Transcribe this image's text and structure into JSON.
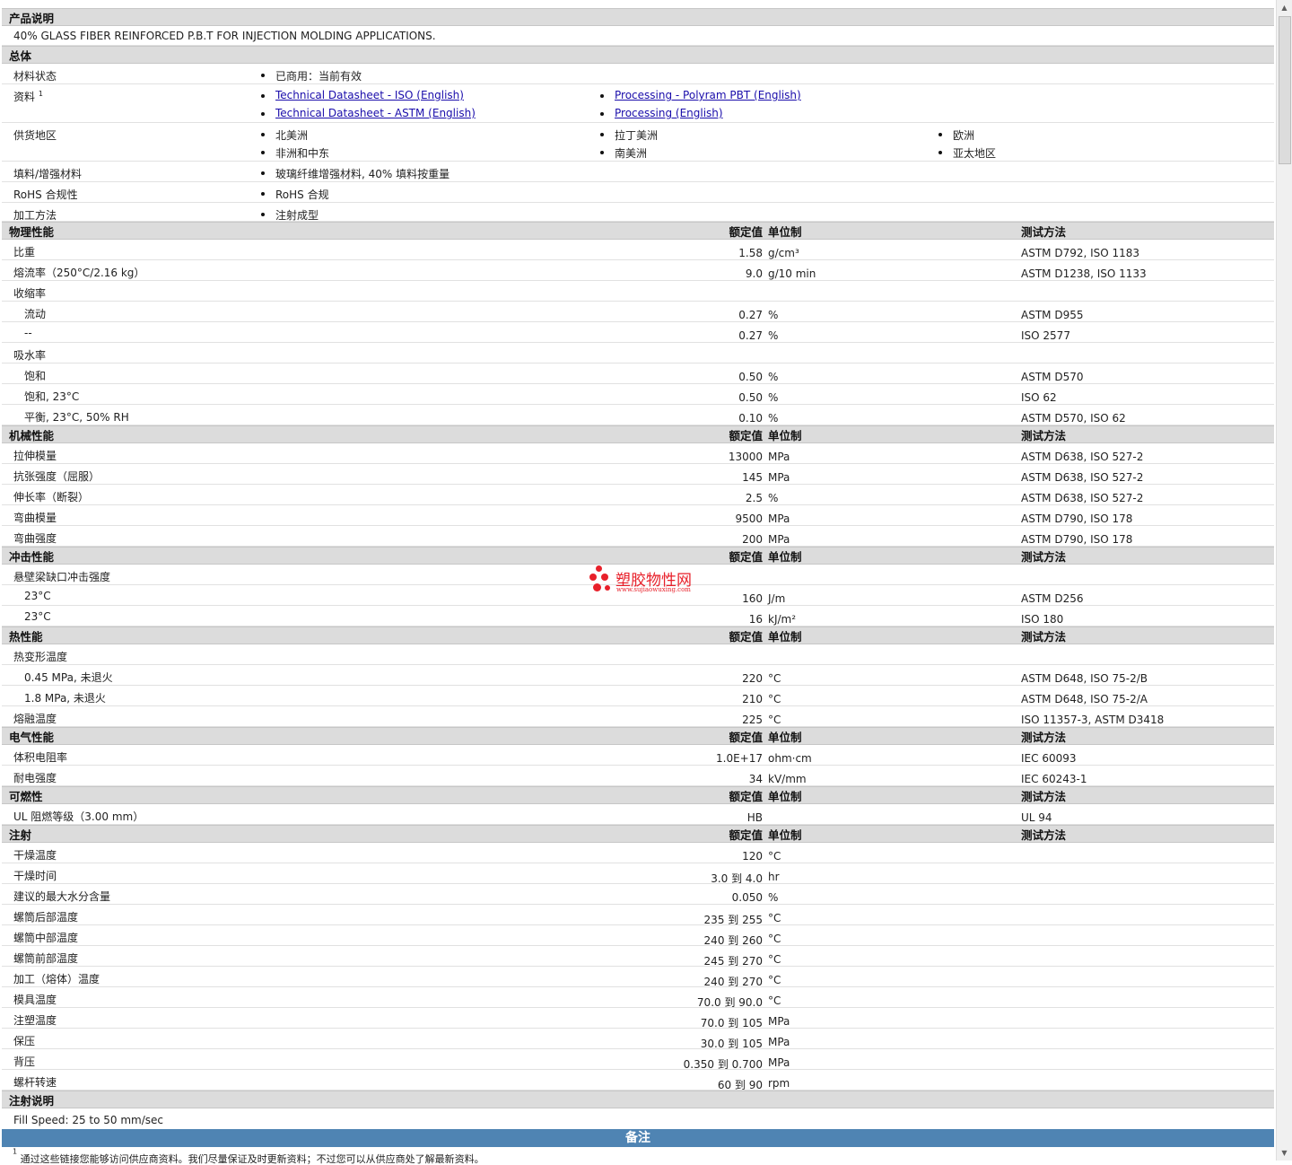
{
  "product_description": {
    "title": "产品说明",
    "text": "40% GLASS FIBER REINFORCED P.B.T FOR INJECTION MOLDING APPLICATIONS."
  },
  "general": {
    "title": "总体",
    "material_status": {
      "label": "材料状态",
      "value": "已商用：当前有效"
    },
    "documents": {
      "label": "资料",
      "sup": "1",
      "links": [
        "Technical Datasheet - ISO (English)",
        "Processing - Polyram PBT (English)",
        "Technical Datasheet - ASTM (English)",
        "Processing (English)"
      ]
    },
    "supply_regions": {
      "label": "供货地区",
      "items": [
        "北美洲",
        "拉丁美洲",
        "欧洲",
        "非洲和中东",
        "南美洲",
        "亚太地区"
      ]
    },
    "filler": {
      "label": "填料/增强材料",
      "value": "玻璃纤维增强材料, 40% 填料按重量"
    },
    "rohs": {
      "label": "RoHS 合规性",
      "value": "RoHS 合规"
    },
    "processing_method": {
      "label": "加工方法",
      "value": "注射成型"
    }
  },
  "headers": {
    "nominal": "额定值",
    "unit": "单位制",
    "method": "测试方法"
  },
  "physical": {
    "title": "物理性能",
    "rows": [
      {
        "label": "比重",
        "value": "1.58",
        "unit": "g/cm³",
        "method": "ASTM D792, ISO 1183"
      },
      {
        "label": "熔流率（250°C/2.16 kg）",
        "value": "9.0",
        "unit": "g/10 min",
        "method": "ASTM D1238, ISO 1133"
      },
      {
        "label": "收缩率",
        "value": "",
        "unit": "",
        "method": ""
      },
      {
        "label": "流动",
        "value": "0.27",
        "unit": "%",
        "method": "ASTM D955"
      },
      {
        "label": "--",
        "value": "0.27",
        "unit": "%",
        "method": "ISO 2577"
      },
      {
        "label": "吸水率",
        "value": "",
        "unit": "",
        "method": ""
      },
      {
        "label": "饱和",
        "value": "0.50",
        "unit": "%",
        "method": "ASTM D570"
      },
      {
        "label": "饱和, 23°C",
        "value": "0.50",
        "unit": "%",
        "method": "ISO 62"
      },
      {
        "label": "平衡, 23°C, 50% RH",
        "value": "0.10",
        "unit": "%",
        "method": "ASTM D570, ISO 62"
      }
    ]
  },
  "mechanical": {
    "title": "机械性能",
    "rows": [
      {
        "label": "拉伸模量",
        "value": "13000",
        "unit": "MPa",
        "method": "ASTM D638, ISO 527-2"
      },
      {
        "label": "抗张强度（屈服）",
        "value": "145",
        "unit": "MPa",
        "method": "ASTM D638, ISO 527-2"
      },
      {
        "label": "伸长率（断裂）",
        "value": "2.5",
        "unit": "%",
        "method": "ASTM D638, ISO 527-2"
      },
      {
        "label": "弯曲模量",
        "value": "9500",
        "unit": "MPa",
        "method": "ASTM D790, ISO 178"
      },
      {
        "label": "弯曲强度",
        "value": "200",
        "unit": "MPa",
        "method": "ASTM D790, ISO 178"
      }
    ]
  },
  "impact": {
    "title": "冲击性能",
    "rows": [
      {
        "label": "悬壁梁缺口冲击强度",
        "value": "",
        "unit": "",
        "method": ""
      },
      {
        "label": "23°C",
        "value": "160",
        "unit": "J/m",
        "method": "ASTM D256"
      },
      {
        "label": "23°C",
        "value": "16",
        "unit": "kJ/m²",
        "method": "ISO 180"
      }
    ]
  },
  "thermal": {
    "title": "热性能",
    "rows": [
      {
        "label": "热变形温度",
        "value": "",
        "unit": "",
        "method": ""
      },
      {
        "label": "0.45 MPa, 未退火",
        "value": "220",
        "unit": "°C",
        "method": "ASTM D648, ISO 75-2/B"
      },
      {
        "label": "1.8 MPa, 未退火",
        "value": "210",
        "unit": "°C",
        "method": "ASTM D648, ISO 75-2/A"
      },
      {
        "label": "熔融温度",
        "value": "225",
        "unit": "°C",
        "method": "ISO 11357-3, ASTM D3418"
      }
    ]
  },
  "electrical": {
    "title": "电气性能",
    "rows": [
      {
        "label": "体积电阻率",
        "value": "1.0E+17",
        "unit": "ohm·cm",
        "method": "IEC 60093"
      },
      {
        "label": "耐电强度",
        "value": "34",
        "unit": "kV/mm",
        "method": "IEC 60243-1"
      }
    ]
  },
  "flammability": {
    "title": "可燃性",
    "rows": [
      {
        "label": "UL 阻燃等级（3.00 mm）",
        "value": "HB",
        "unit": "",
        "method": "UL 94"
      }
    ]
  },
  "injection": {
    "title": "注射",
    "rows": [
      {
        "label": "干燥温度",
        "value": "120",
        "unit": "°C",
        "method": ""
      },
      {
        "label": "干燥时间",
        "value": "3.0 到  4.0",
        "unit": "hr",
        "method": ""
      },
      {
        "label": "建议的最大水分含量",
        "value": "0.050",
        "unit": "%",
        "method": ""
      },
      {
        "label": "螺筒后部温度",
        "value": "235 到  255",
        "unit": "°C",
        "method": ""
      },
      {
        "label": "螺筒中部温度",
        "value": "240 到  260",
        "unit": "°C",
        "method": ""
      },
      {
        "label": "螺筒前部温度",
        "value": "245 到  270",
        "unit": "°C",
        "method": ""
      },
      {
        "label": "加工（熔体）温度",
        "value": "240 到  270",
        "unit": "°C",
        "method": ""
      },
      {
        "label": "模具温度",
        "value": "70.0 到  90.0",
        "unit": "°C",
        "method": ""
      },
      {
        "label": "注塑温度",
        "value": "70.0 到  105",
        "unit": "MPa",
        "method": ""
      },
      {
        "label": "保压",
        "value": "30.0 到  105",
        "unit": "MPa",
        "method": ""
      },
      {
        "label": "背压",
        "value": "0.350 到  0.700",
        "unit": "MPa",
        "method": ""
      },
      {
        "label": "螺杆转速",
        "value": "60 到  90",
        "unit": "rpm",
        "method": ""
      }
    ]
  },
  "injection_notes": {
    "title": "注射说明",
    "text": "Fill Speed: 25 to 50 mm/sec"
  },
  "remarks": {
    "title": "备注",
    "footnote_num": "1",
    "footnote_text": "通过这些链接您能够访问供应商资料。我们尽量保证及时更新资料；不过您可以从供应商处了解最新资料。"
  },
  "watermark": {
    "name": "塑胶物性网",
    "url": "www.sujiaowuxing.com"
  },
  "scrollbar": {
    "position": 0.0
  }
}
